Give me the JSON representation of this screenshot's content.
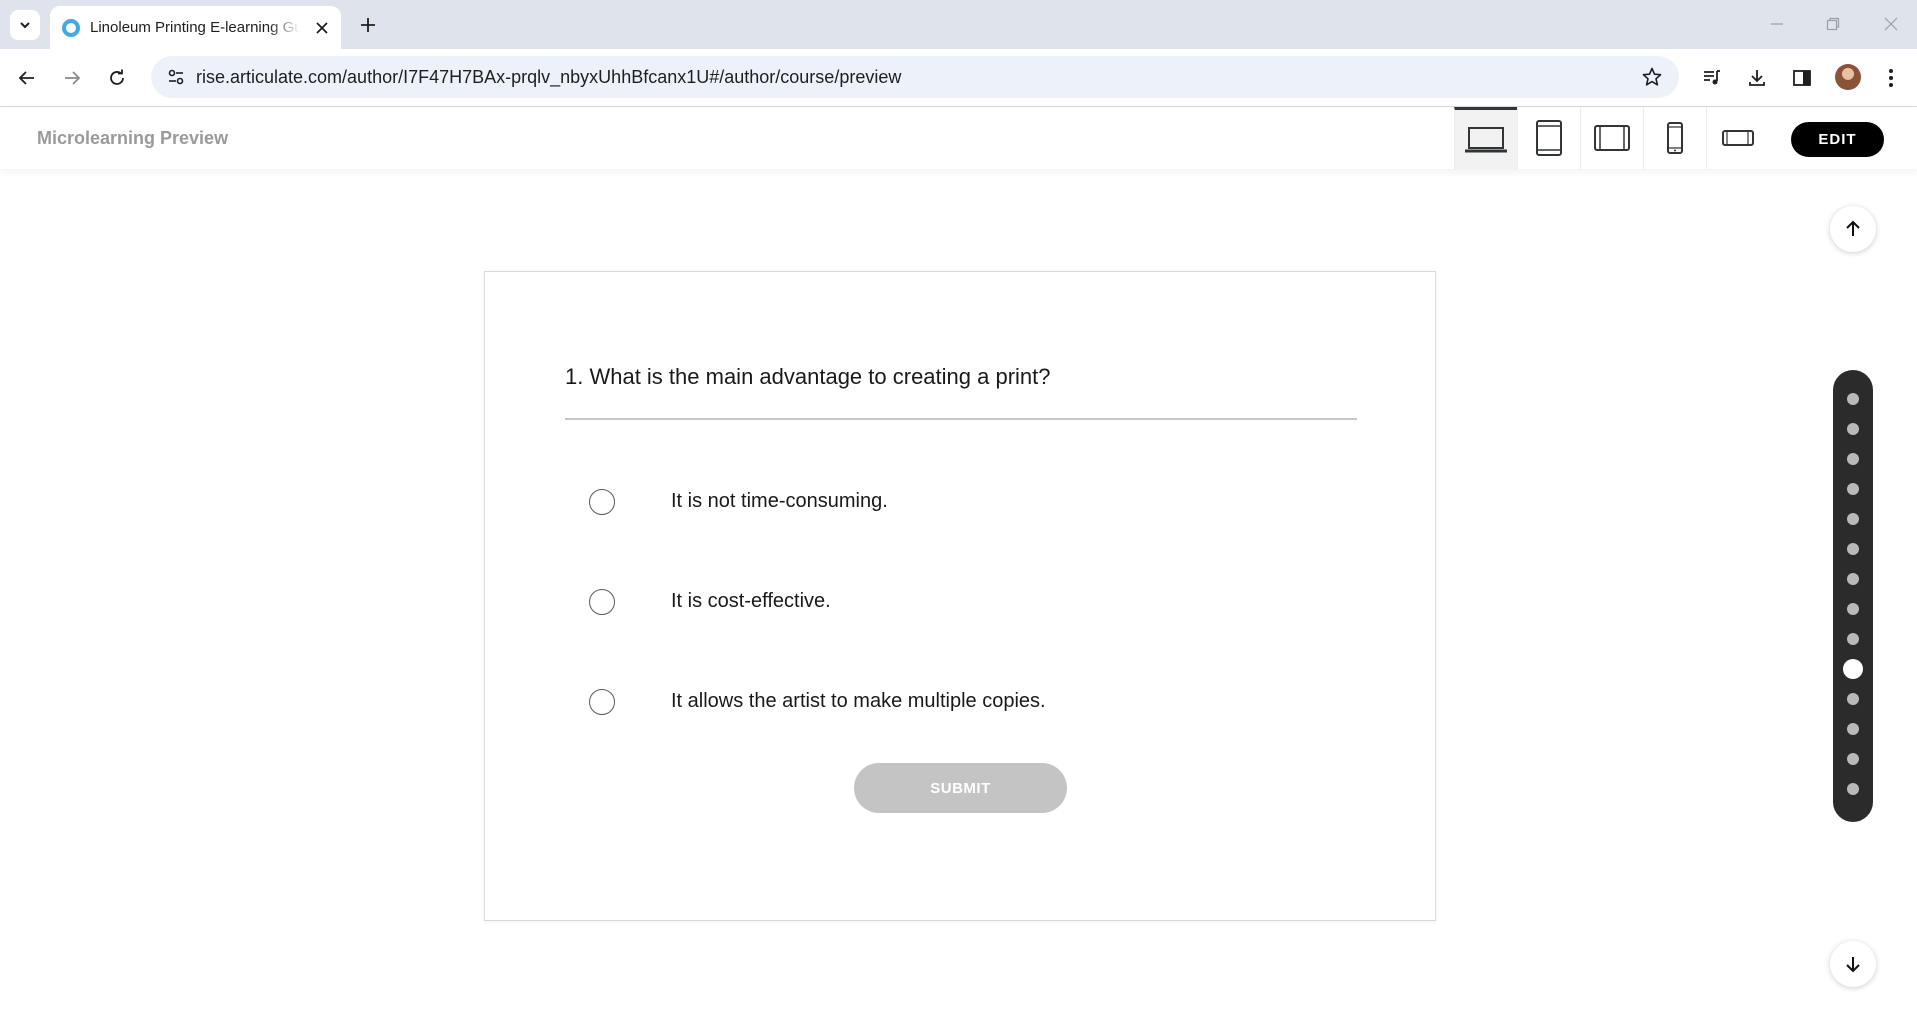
{
  "browser": {
    "tab_title": "Linoleum Printing E-learning Gu",
    "url": "rise.articulate.com/author/I7F47H7BAx-prqlv_nbyxUhhBfcanx1U#/author/course/preview"
  },
  "preview": {
    "title": "Microlearning Preview",
    "devices": [
      "desktop",
      "tablet-portrait",
      "tablet-landscape",
      "phone-portrait",
      "phone-landscape"
    ],
    "active_device": "desktop",
    "edit_label": "EDIT"
  },
  "quiz": {
    "question": "1. What is the main advantage to creating a print?",
    "options": [
      "It is not time-consuming.",
      "It is cost-effective.",
      "It allows the artist to make multiple copies."
    ],
    "submit_label": "SUBMIT"
  },
  "navigation": {
    "progress_total": 14,
    "progress_current": 10
  },
  "colors": {
    "accent_dark": "#000000",
    "submit_disabled": "#c4c4c4",
    "rail_bg": "#2b2b2b",
    "favicon": "#40a9e6"
  }
}
